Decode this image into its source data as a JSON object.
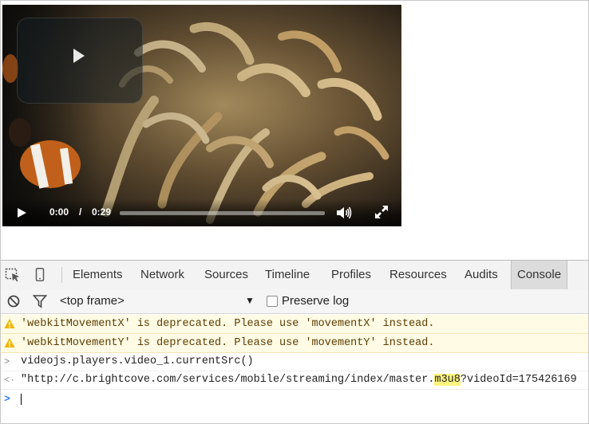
{
  "video": {
    "current_time": "0:00",
    "separator": "/",
    "duration": "0:29",
    "progress_fraction": 0.0,
    "icons": [
      "big-play-icon",
      "play-icon",
      "volume-icon",
      "fullscreen-icon"
    ]
  },
  "devtools": {
    "tool_icons": [
      "inspect-element-icon",
      "device-mode-icon"
    ],
    "tabs": [
      {
        "label": "Elements",
        "active": false
      },
      {
        "label": "Network",
        "active": false
      },
      {
        "label": "Sources",
        "active": false
      },
      {
        "label": "Timeline",
        "active": false
      },
      {
        "label": "Profiles",
        "active": false
      },
      {
        "label": "Resources",
        "active": false
      },
      {
        "label": "Audits",
        "active": false
      },
      {
        "label": "Console",
        "active": true
      }
    ],
    "toolbar": {
      "clear_icon": "clear-console-icon",
      "filter_icon": "filter-icon",
      "frame_selector": "<top frame>",
      "preserve_log_label": "Preserve log",
      "preserve_log_checked": false
    },
    "console": {
      "warnings": [
        "'webkitMovementX' is deprecated. Please use 'movementX' instead.",
        "'webkitMovementY' is deprecated. Please use 'movementY' instead."
      ],
      "command": "videojs.players.video_1.currentSrc()",
      "result": {
        "before": "\"http://c.brightcove.com/services/mobile/streaming/index/master.",
        "highlight": "m3u8",
        "after": "?videoId=175426169"
      },
      "prompt": ""
    },
    "colors": {
      "warning_bg": "#fffbe5",
      "warning_icon": "#f5b400",
      "highlight": "#fef47e",
      "prompt_blue": "#2f7bea"
    }
  }
}
